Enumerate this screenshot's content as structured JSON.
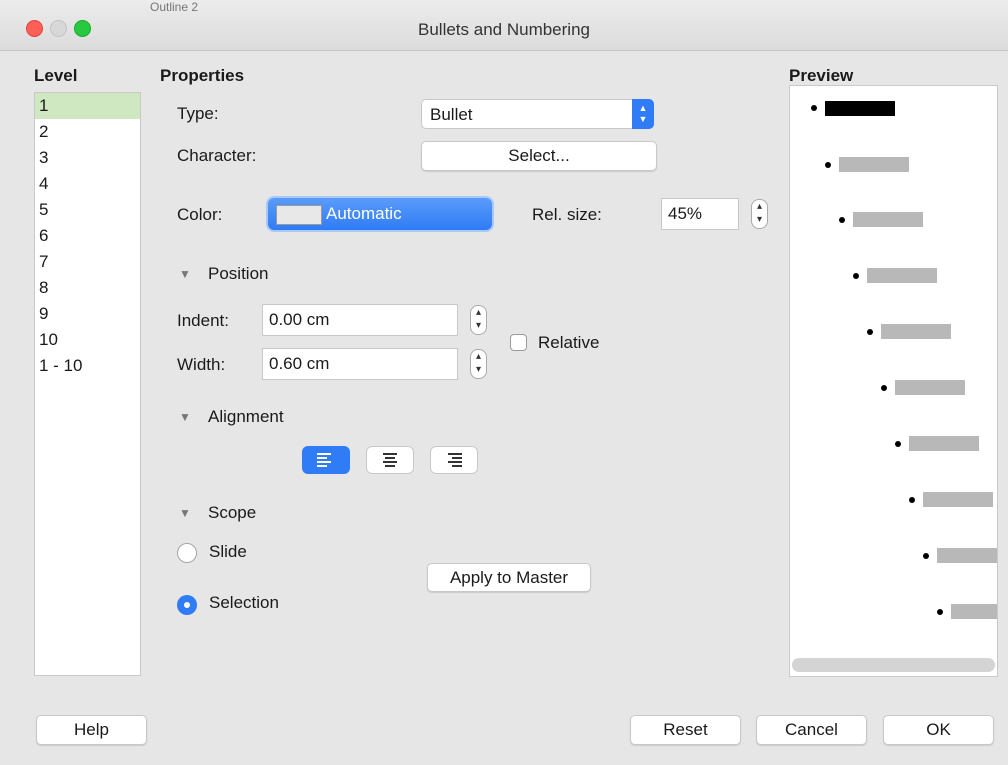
{
  "window": {
    "title": "Bullets and Numbering",
    "behind_text": "Outline 2"
  },
  "level": {
    "header": "Level",
    "items": [
      "1",
      "2",
      "3",
      "4",
      "5",
      "6",
      "7",
      "8",
      "9",
      "10",
      "1 - 10"
    ],
    "selected_index": 0
  },
  "properties": {
    "header": "Properties",
    "type_label": "Type:",
    "type_value": "Bullet",
    "character_label": "Character:",
    "select_button": "Select...",
    "color_label": "Color:",
    "color_value": "Automatic",
    "relsize_label": "Rel. size:",
    "relsize_value": "45%"
  },
  "position": {
    "header": "Position",
    "indent_label": "Indent:",
    "indent_value": "0.00 cm",
    "width_label": "Width:",
    "width_value": "0.60 cm",
    "relative_label": "Relative",
    "relative_checked": false
  },
  "alignment": {
    "header": "Alignment",
    "selected": "left",
    "options": [
      "left",
      "center",
      "right"
    ]
  },
  "scope": {
    "header": "Scope",
    "slide_label": "Slide",
    "selection_label": "Selection",
    "selected": "selection",
    "apply_master": "Apply to Master"
  },
  "preview": {
    "header": "Preview"
  },
  "buttons": {
    "help": "Help",
    "reset": "Reset",
    "cancel": "Cancel",
    "ok": "OK"
  },
  "colors": {
    "accent": "#2f7cf6",
    "selected_row": "#cfe8c2"
  },
  "icons": {
    "close": "close-dot-icon",
    "minimize": "minimize-dot-icon",
    "zoom": "zoom-dot-icon",
    "disclosure": "disclosure-triangle-icon"
  }
}
